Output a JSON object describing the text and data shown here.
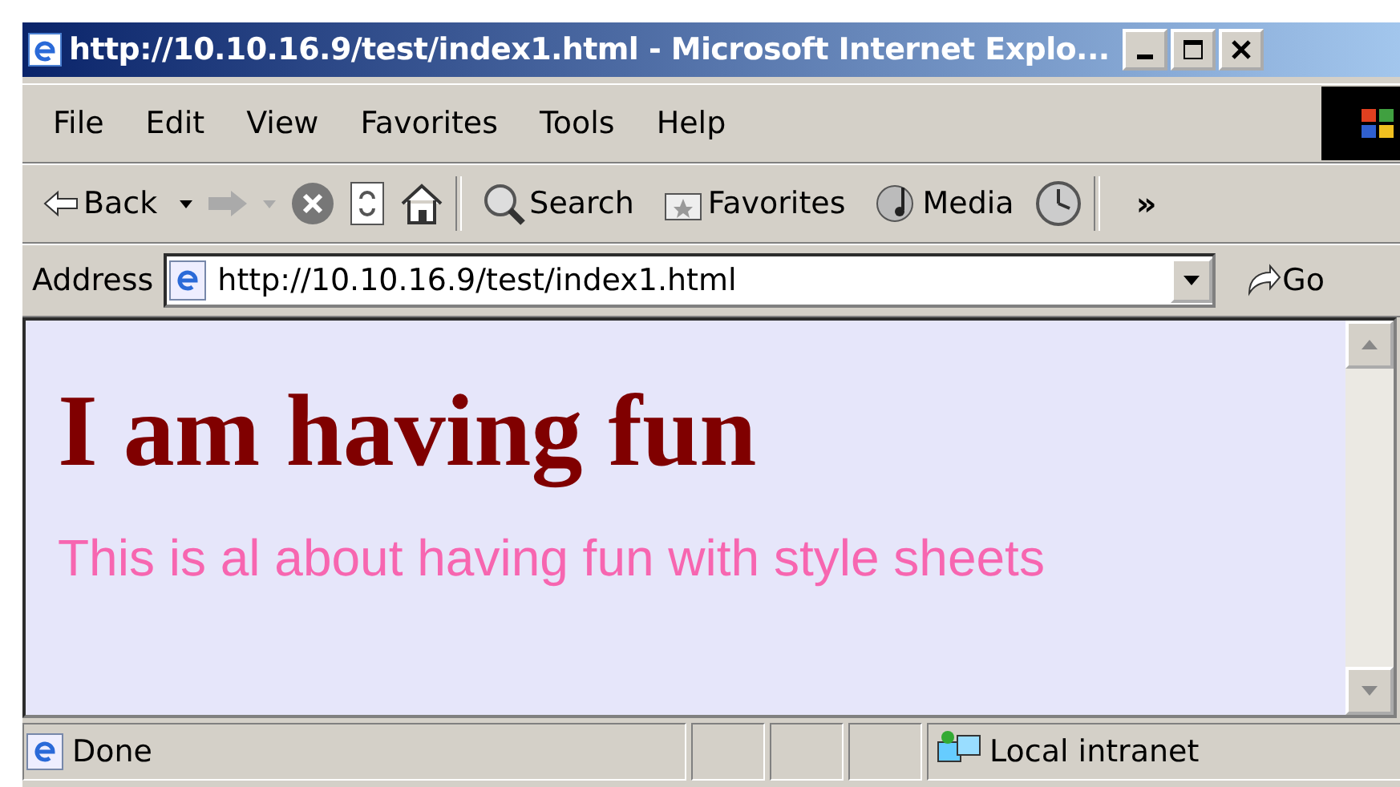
{
  "window": {
    "title": "http://10.10.16.9/test/index1.html - Microsoft Internet Explo..."
  },
  "menu": [
    "File",
    "Edit",
    "View",
    "Favorites",
    "Tools",
    "Help"
  ],
  "toolbar": {
    "back": "Back",
    "search": "Search",
    "favorites": "Favorites",
    "media": "Media",
    "more": "»"
  },
  "address": {
    "label": "Address",
    "value": "http://10.10.16.9/test/index1.html",
    "go": "Go"
  },
  "page": {
    "heading": "I am having fun",
    "paragraph": "This is al about having fun with style sheets"
  },
  "status_bar": {
    "status": "Done",
    "zone": "Local intranet"
  }
}
